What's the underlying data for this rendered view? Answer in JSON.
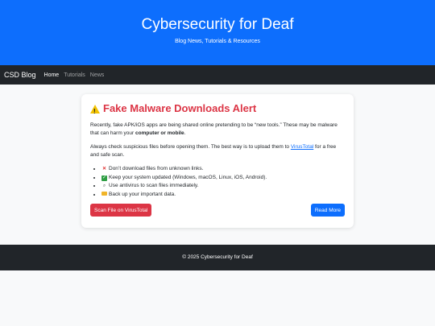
{
  "hero": {
    "title": "Cybersecurity for Deaf",
    "subtitle": "Blog News, Tutorials & Resources"
  },
  "navbar": {
    "brand": "CSD Blog",
    "links": [
      "Home",
      "Tutorials",
      "News"
    ]
  },
  "alert_card": {
    "icon": "warning-icon",
    "title": "Fake Malware Downloads Alert",
    "para1_text": "Recently, fake APK/iOS apps are being shared online pretending to be “new tools.” These may be malware that can harm your ",
    "para1_bold1": "computer or mobile",
    "para1_end": ".",
    "para2_text": "Always check suspicious files before opening them. The best way is to upload them to ",
    "para2_link": "VirusTotal",
    "para2_end": " for a free and safe scan.",
    "tips": [
      {
        "icon": "cross-mark-icon",
        "text": "Don’t download files from unknown links."
      },
      {
        "icon": "check-mark-icon",
        "text": "Keep your system updated (Windows, macOS, Linux, iOS, Android)."
      },
      {
        "icon": "magnifier-icon",
        "text": "Use antivirus to scan files immediately."
      },
      {
        "icon": "folder-icon",
        "text": "Back up your important data."
      }
    ],
    "scan_button": "Scan File on VirusTotal",
    "read_more_button": "Read More"
  },
  "footer": {
    "text": "© 2025 Cybersecurity for Deaf"
  },
  "colors": {
    "primary": "#0d6efd",
    "danger": "#dc3545",
    "dark": "#212529"
  }
}
